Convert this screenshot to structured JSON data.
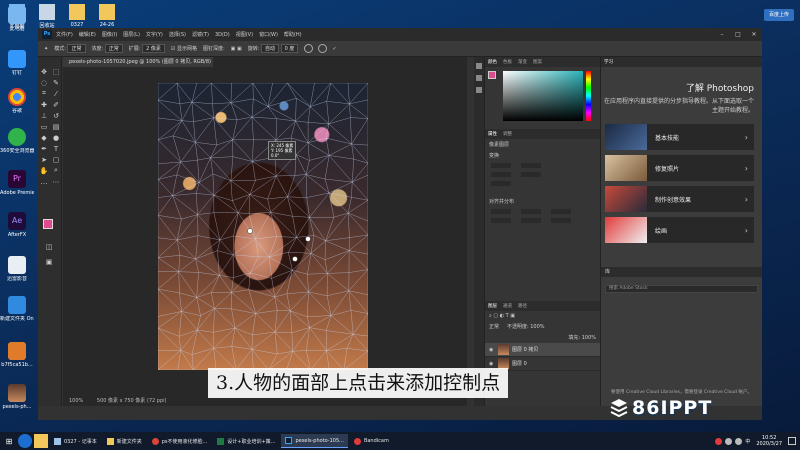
{
  "desktop": {
    "top_icons": [
      {
        "label": "此电脑",
        "icon": "computer-icon"
      },
      {
        "label": "回收站",
        "icon": "recycle-bin-icon"
      },
      {
        "label": "0327",
        "icon": "folder-icon"
      },
      {
        "label": "24-26",
        "icon": "folder-icon"
      }
    ],
    "left_icons": [
      {
        "label": "此电脑",
        "icon": "computer-icon"
      },
      {
        "label": "钉钉",
        "icon": "dingtalk-icon"
      },
      {
        "label": "谷歌",
        "icon": "chrome-icon"
      },
      {
        "label": "360安全浏览器",
        "icon": "360-browser-icon"
      },
      {
        "label": "Adobe Premie...",
        "icon": "premiere-icon"
      },
      {
        "label": "AfterFX",
        "icon": "after-effects-icon"
      },
      {
        "label": "迅雷影音",
        "icon": "xunlei-icon"
      },
      {
        "label": "新建文件夹 Online",
        "icon": "app-icon"
      },
      {
        "label": "b7f5ca51b...",
        "icon": "shortcut-icon"
      },
      {
        "label": "pexels-ph...",
        "icon": "image-file-icon"
      }
    ],
    "cloud_button": "百度上传"
  },
  "photoshop": {
    "menu": [
      "文件(F)",
      "编辑(E)",
      "图像(I)",
      "图层(L)",
      "文字(Y)",
      "选择(S)",
      "滤镜(T)",
      "3D(D)",
      "视图(V)",
      "窗口(W)",
      "帮助(H)"
    ],
    "options": {
      "mode_label": "模式:",
      "mode_value": "正常",
      "density_label": "浓度:",
      "density_value": "正常",
      "expand_label": "扩展:",
      "expand_value": "2 像素",
      "show_mesh": "显示网格",
      "pin_depth_label": "图钉深度:",
      "rotate_label": "旋转:",
      "rotate_value": "自动",
      "rotate_deg": "0 度"
    },
    "document_tab": "pexels-photo-1057020.jpeg @ 100% (图层 0 拷贝, RGB/8)",
    "coords_readout": [
      "X: 245 像素",
      "Y: 195 像素",
      "0.0°"
    ],
    "status": {
      "zoom": "100%",
      "doc_size": "500 像素 x 750 像素 (72 ppi)"
    },
    "subtitle": "3.人物的面部上点击来添加控制点",
    "color_panel": {
      "tabs": [
        "颜色",
        "色板",
        "渐变",
        "图案"
      ],
      "fg": "#e04b8d"
    },
    "properties_panel": {
      "tabs": [
        "属性",
        "调整"
      ],
      "subtitle": "像素图层",
      "transform": "变换",
      "align": "对齐并分布"
    },
    "layers_panel": {
      "tabs": [
        "图层",
        "通道",
        "路径"
      ],
      "blend": "正常",
      "opacity_label": "不透明度:",
      "opacity": "100%",
      "fill_label": "填充:",
      "fill": "100%",
      "layers": [
        "图层 0 拷贝",
        "图层 0"
      ]
    },
    "learn_panel": {
      "tab": "学习",
      "title": "了解 Photoshop",
      "description": "在应用程序内直接提供的分步指导教程。从下面选取一个主题开始教程。",
      "cards": [
        "基本技能",
        "修复照片",
        "制作创意效果",
        "绘画"
      ]
    },
    "libraries_panel": {
      "tab": "库",
      "search": "搜索 Adobe Stock",
      "message": "要使用 Creative Cloud Libraries，需要登录 Creative Cloud 帐户。"
    }
  },
  "taskbar": {
    "tasks": [
      "0327 - 记事本",
      "新建文件夹",
      "ps不使用液化修脸...",
      "设计+职业培训+策...",
      "pexels-photo-105...",
      "Bandicam"
    ],
    "active_task": "pexels-photo-105...",
    "time": "10:52",
    "date": "2020/3/27",
    "ime": "中"
  },
  "watermark": "86IPPT"
}
